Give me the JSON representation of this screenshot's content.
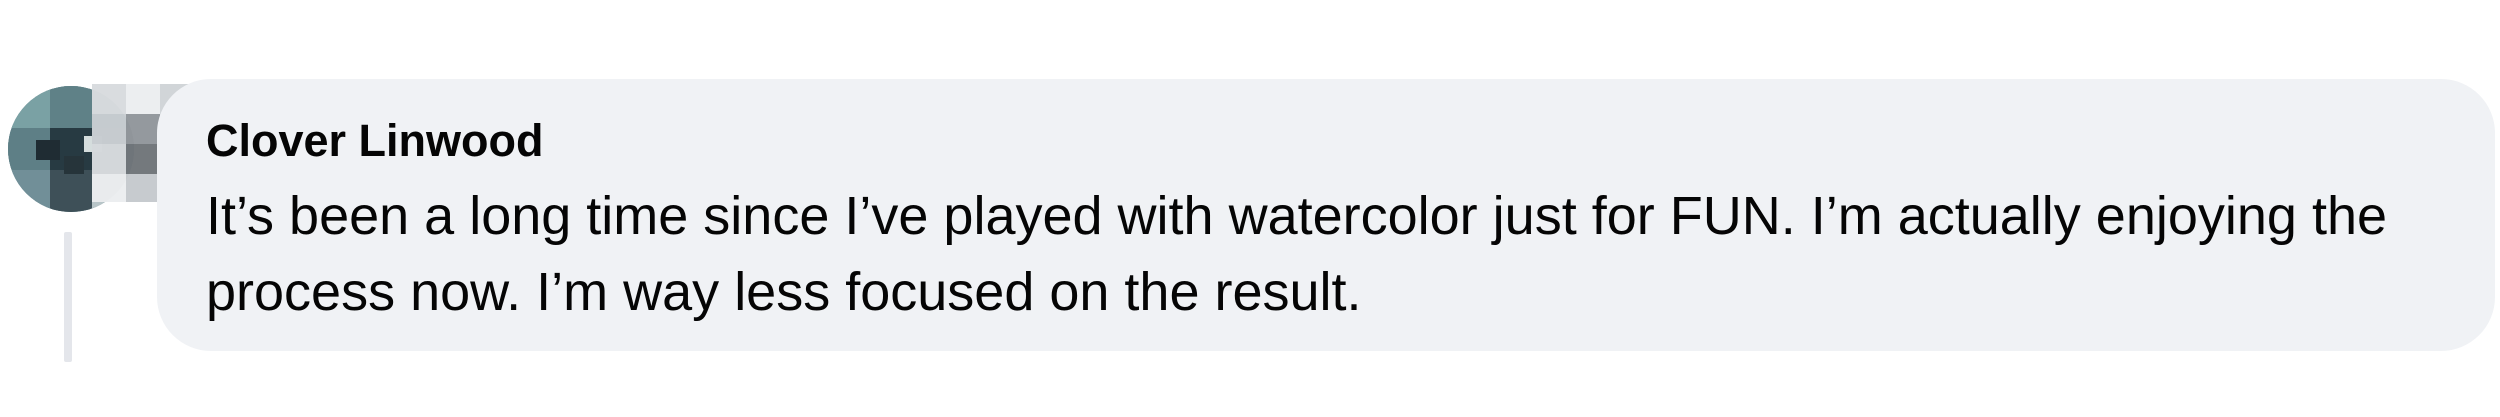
{
  "comment": {
    "author": "Clover Linwood",
    "text": "It’s been a long time since I’ve played with watercolor just for FUN. I’m actually enjoying the process now. I’m way less focused on the result."
  },
  "icons": {
    "avatar": "profile-photo"
  },
  "colors": {
    "bubble": "#f0f2f5",
    "text": "#050505",
    "thread_line": "#e4e6eb"
  }
}
